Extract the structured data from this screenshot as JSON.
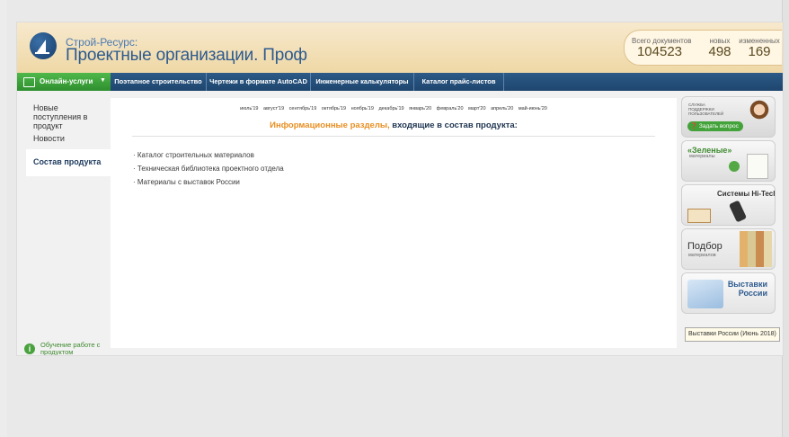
{
  "header": {
    "brand_top": "Строй-Ресурс:",
    "brand_main": "Проектные организации. Проф",
    "stats": [
      {
        "label": "Всего документов",
        "value": "104523"
      },
      {
        "label": "новых",
        "value": "498"
      },
      {
        "label": "измененных",
        "value": "169"
      }
    ]
  },
  "nav": {
    "first": "Онлайн-услуги",
    "items": [
      "Поэтапное строительство",
      "Чертежи в формате AutoCAD",
      "Инженерные калькуляторы",
      "Каталог прайс-листов"
    ]
  },
  "sidebar": {
    "items": [
      "Новые поступления в продукт",
      "Новости",
      "Состав продукта"
    ],
    "help": "Обучение работе с продуктом"
  },
  "main": {
    "months": [
      "июль'19",
      "август'19",
      "сентябрь'19",
      "октябрь'19",
      "ноябрь'19",
      "декабрь'19",
      "январь'20",
      "февраль'20",
      "март'20",
      "апрель'20",
      "май-июнь'20"
    ],
    "title_orange": "Информационные разделы,",
    "title_dark": "входящие в состав продукта:",
    "list": [
      "Каталог строительных материалов",
      "Техническая библиотека проектного отдела",
      "Материалы с выставок России"
    ]
  },
  "promos": {
    "support_small": "СЛУЖБА ПОДДЕРЖКИ ПОЛЬЗОВАТЕЛЕЙ",
    "support_btn": "Задать вопрос",
    "green_title": "«Зеленые»",
    "green_sub": "материалы",
    "hitech": "Системы Hi-Tech",
    "select_title": "Подбор",
    "select_sub": "материалов",
    "expo_1": "Выставки",
    "expo_2": "России"
  },
  "tooltip": "Выставки России (Июнь 2018)",
  "colors": {
    "nav_blue": "#1e466e",
    "accent_green": "#49a23e",
    "accent_orange": "#e88f22"
  }
}
